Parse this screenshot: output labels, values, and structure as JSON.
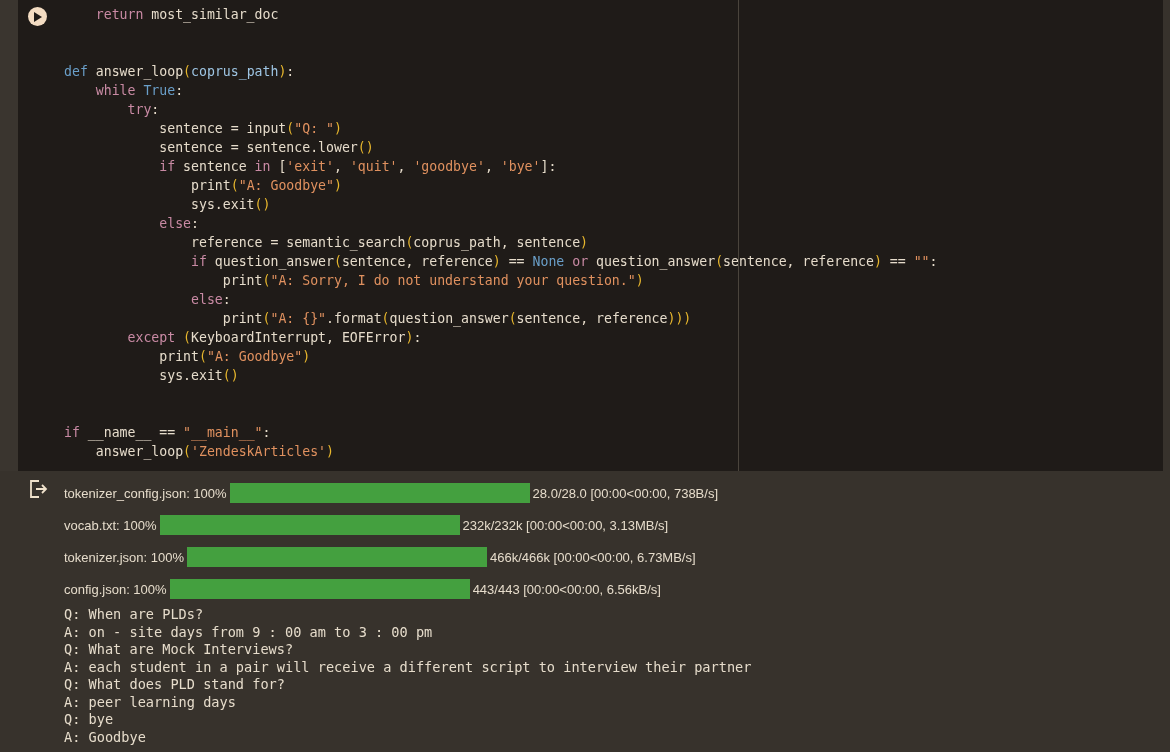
{
  "code_cell": {
    "lines": [
      {
        "kind": "code",
        "tokens": [
          {
            "kind": "keyword",
            "text": "    return"
          },
          {
            "kind": "plain",
            "text": " most_similar_doc"
          }
        ]
      },
      {
        "kind": "blank"
      },
      {
        "kind": "blank"
      },
      {
        "kind": "code",
        "tokens": [
          {
            "kind": "const",
            "text": "def"
          },
          {
            "kind": "plain",
            "text": " answer_loop"
          },
          {
            "kind": "paren",
            "text": "("
          },
          {
            "kind": "param",
            "text": "coprus_path"
          },
          {
            "kind": "paren",
            "text": ")"
          },
          {
            "kind": "plain",
            "text": ":"
          }
        ]
      },
      {
        "kind": "code",
        "tokens": [
          {
            "kind": "keyword",
            "text": "    while"
          },
          {
            "kind": "const",
            "text": " True"
          },
          {
            "kind": "plain",
            "text": ":"
          }
        ]
      },
      {
        "kind": "code",
        "tokens": [
          {
            "kind": "keyword",
            "text": "        try"
          },
          {
            "kind": "plain",
            "text": ":"
          }
        ]
      },
      {
        "kind": "code",
        "tokens": [
          {
            "kind": "plain",
            "text": "            sentence = input"
          },
          {
            "kind": "paren",
            "text": "("
          },
          {
            "kind": "string",
            "text": "\"Q: \""
          },
          {
            "kind": "paren",
            "text": ")"
          }
        ]
      },
      {
        "kind": "code",
        "tokens": [
          {
            "kind": "plain",
            "text": "            sentence = sentence.lower"
          },
          {
            "kind": "paren",
            "text": "()"
          }
        ]
      },
      {
        "kind": "code",
        "tokens": [
          {
            "kind": "keyword",
            "text": "            if"
          },
          {
            "kind": "plain",
            "text": " sentence "
          },
          {
            "kind": "keyword",
            "text": "in"
          },
          {
            "kind": "plain",
            "text": " ["
          },
          {
            "kind": "string",
            "text": "'exit'"
          },
          {
            "kind": "plain",
            "text": ", "
          },
          {
            "kind": "string",
            "text": "'quit'"
          },
          {
            "kind": "plain",
            "text": ", "
          },
          {
            "kind": "string",
            "text": "'goodbye'"
          },
          {
            "kind": "plain",
            "text": ", "
          },
          {
            "kind": "string",
            "text": "'bye'"
          },
          {
            "kind": "plain",
            "text": "]:"
          }
        ]
      },
      {
        "kind": "code",
        "tokens": [
          {
            "kind": "plain",
            "text": "                print"
          },
          {
            "kind": "paren",
            "text": "("
          },
          {
            "kind": "string",
            "text": "\"A: Goodbye\""
          },
          {
            "kind": "paren",
            "text": ")"
          }
        ]
      },
      {
        "kind": "code",
        "tokens": [
          {
            "kind": "plain",
            "text": "                sys.exit"
          },
          {
            "kind": "paren",
            "text": "()"
          }
        ]
      },
      {
        "kind": "code",
        "tokens": [
          {
            "kind": "keyword",
            "text": "            else"
          },
          {
            "kind": "plain",
            "text": ":"
          }
        ]
      },
      {
        "kind": "code",
        "tokens": [
          {
            "kind": "plain",
            "text": "                reference = semantic_search"
          },
          {
            "kind": "paren",
            "text": "("
          },
          {
            "kind": "plain",
            "text": "coprus_path, sentence"
          },
          {
            "kind": "paren",
            "text": ")"
          }
        ]
      },
      {
        "kind": "code",
        "tokens": [
          {
            "kind": "keyword",
            "text": "                if"
          },
          {
            "kind": "plain",
            "text": " question_answer"
          },
          {
            "kind": "paren",
            "text": "("
          },
          {
            "kind": "plain",
            "text": "sentence, reference"
          },
          {
            "kind": "paren",
            "text": ")"
          },
          {
            "kind": "plain",
            "text": " == "
          },
          {
            "kind": "const",
            "text": "None"
          },
          {
            "kind": "keyword",
            "text": " or"
          },
          {
            "kind": "plain",
            "text": " question_answer"
          },
          {
            "kind": "paren",
            "text": "("
          },
          {
            "kind": "plain",
            "text": "sentence, reference"
          },
          {
            "kind": "paren",
            "text": ")"
          },
          {
            "kind": "plain",
            "text": " == "
          },
          {
            "kind": "string",
            "text": "\"\""
          },
          {
            "kind": "plain",
            "text": ":"
          }
        ]
      },
      {
        "kind": "code",
        "tokens": [
          {
            "kind": "plain",
            "text": "                    print"
          },
          {
            "kind": "paren",
            "text": "("
          },
          {
            "kind": "string",
            "text": "\"A: Sorry, I do not understand your question.\""
          },
          {
            "kind": "paren",
            "text": ")"
          }
        ]
      },
      {
        "kind": "code",
        "tokens": [
          {
            "kind": "keyword",
            "text": "                else"
          },
          {
            "kind": "plain",
            "text": ":"
          }
        ]
      },
      {
        "kind": "code",
        "tokens": [
          {
            "kind": "plain",
            "text": "                    print"
          },
          {
            "kind": "paren",
            "text": "("
          },
          {
            "kind": "string",
            "text": "\"A: {}\""
          },
          {
            "kind": "plain",
            "text": ".format"
          },
          {
            "kind": "paren",
            "text": "("
          },
          {
            "kind": "plain",
            "text": "question_answer"
          },
          {
            "kind": "paren",
            "text": "("
          },
          {
            "kind": "plain",
            "text": "sentence, reference"
          },
          {
            "kind": "paren",
            "text": ")))"
          }
        ]
      },
      {
        "kind": "code",
        "tokens": [
          {
            "kind": "keyword",
            "text": "        except"
          },
          {
            "kind": "paren",
            "text": " ("
          },
          {
            "kind": "plain",
            "text": "KeyboardInterrupt, EOFError"
          },
          {
            "kind": "paren",
            "text": ")"
          },
          {
            "kind": "plain",
            "text": ":"
          }
        ]
      },
      {
        "kind": "code",
        "tokens": [
          {
            "kind": "plain",
            "text": "            print"
          },
          {
            "kind": "paren",
            "text": "("
          },
          {
            "kind": "string",
            "text": "\"A: Goodbye\""
          },
          {
            "kind": "paren",
            "text": ")"
          }
        ]
      },
      {
        "kind": "code",
        "tokens": [
          {
            "kind": "plain",
            "text": "            sys.exit"
          },
          {
            "kind": "paren",
            "text": "()"
          }
        ]
      },
      {
        "kind": "blank"
      },
      {
        "kind": "blank"
      },
      {
        "kind": "code",
        "tokens": [
          {
            "kind": "keyword",
            "text": "if"
          },
          {
            "kind": "plain",
            "text": " __name__ == "
          },
          {
            "kind": "string",
            "text": "\"__main__\""
          },
          {
            "kind": "plain",
            "text": ":"
          }
        ]
      },
      {
        "kind": "code",
        "tokens": [
          {
            "kind": "plain",
            "text": "    answer_loop"
          },
          {
            "kind": "paren",
            "text": "("
          },
          {
            "kind": "string",
            "text": "'ZendeskArticles'"
          },
          {
            "kind": "paren",
            "text": ")"
          }
        ]
      }
    ]
  },
  "output": {
    "progress": [
      {
        "label": "tokenizer_config.json: 100%",
        "level": 1,
        "stats": "28.0/28.0 [00:00<00:00, 738B/s]"
      },
      {
        "label": "vocab.txt: 100%",
        "level": 1,
        "stats": "232k/232k [00:00<00:00, 3.13MB/s]"
      },
      {
        "label": "tokenizer.json: 100%",
        "level": 1,
        "stats": "466k/466k [00:00<00:00, 6.73MB/s]"
      },
      {
        "label": "config.json: 100%",
        "level": 1,
        "stats": "443/443 [00:00<00:00, 6.56kB/s]"
      }
    ],
    "text_lines": [
      "Q: When are PLDs?",
      "A: on - site days from 9 : 00 am to 3 : 00 pm",
      "Q: What are Mock Interviews?",
      "A: each student in a pair will receive a different script to interview their partner",
      "Q: What does PLD stand for?",
      "A: peer learning days",
      "Q: bye",
      "A: Goodbye"
    ]
  }
}
